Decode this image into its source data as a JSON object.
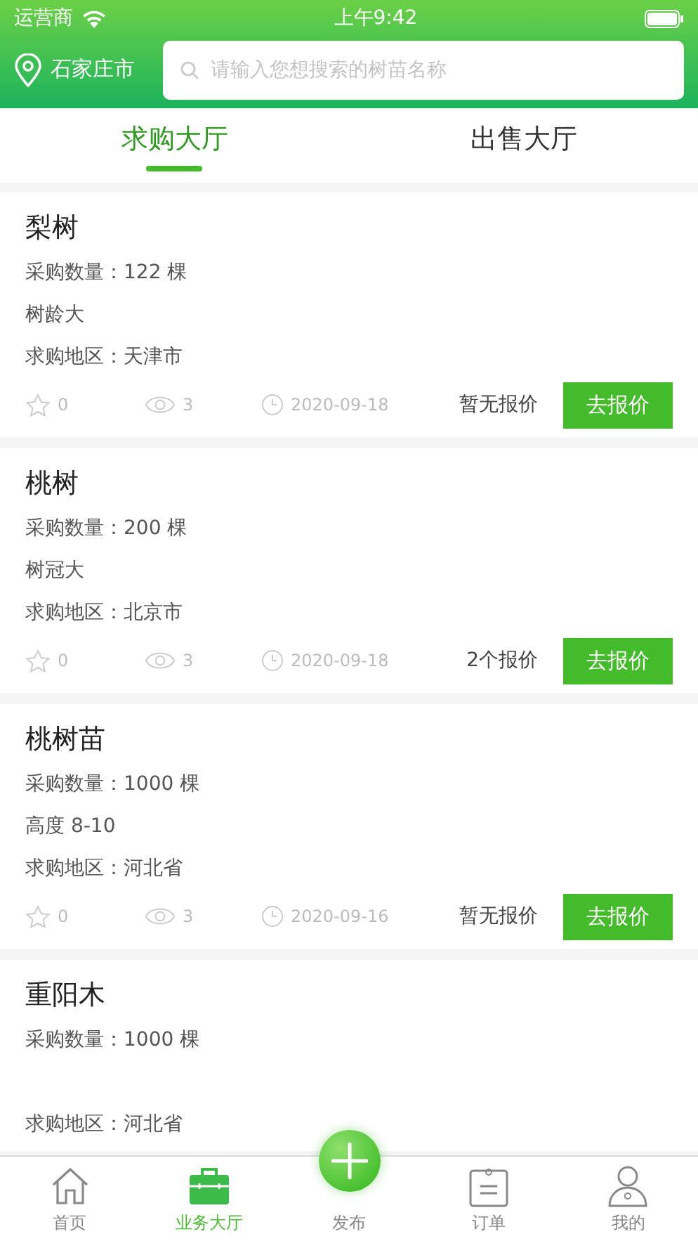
{
  "status_bar": {
    "carrier": "运营商",
    "time": "上午9:42"
  },
  "header": {
    "city": "石家庄市",
    "search": {
      "placeholder": "请输入您想搜索的树苗名称"
    }
  },
  "tabs": [
    {
      "label": "求购大厅",
      "selected": true
    },
    {
      "label": "出售大厅",
      "selected": false
    }
  ],
  "listings": [
    {
      "title": "梨树",
      "quantity": "采购数量：122 棵",
      "spec": "树龄大",
      "region": "求购地区：天津市",
      "favorites": "0",
      "views": "3",
      "date": "2020-09-18",
      "quote_status": "暂无报价",
      "action": "去报价"
    },
    {
      "title": "桃树",
      "quantity": "采购数量：200 棵",
      "spec": "树冠大",
      "region": "求购地区：北京市",
      "favorites": "0",
      "views": "3",
      "date": "2020-09-18",
      "quote_status": "2个报价",
      "action": "去报价"
    },
    {
      "title": "桃树苗",
      "quantity": "采购数量：1000 棵",
      "spec": "高度 8-10",
      "region": "求购地区：河北省",
      "favorites": "0",
      "views": "3",
      "date": "2020-09-16",
      "quote_status": "暂无报价",
      "action": "去报价"
    },
    {
      "title": "重阳木",
      "quantity": "采购数量：1000 棵",
      "region": "求购地区：河北省"
    }
  ],
  "tab_bar": [
    {
      "kind": "home",
      "label": "首页",
      "selected": false
    },
    {
      "kind": "briefcase",
      "label": "业务大厅",
      "selected": true
    },
    {
      "kind": "publish",
      "label": "发布",
      "selected": false
    },
    {
      "kind": "orders",
      "label": "订单",
      "selected": false
    },
    {
      "kind": "profile",
      "label": "我的",
      "selected": false
    }
  ]
}
